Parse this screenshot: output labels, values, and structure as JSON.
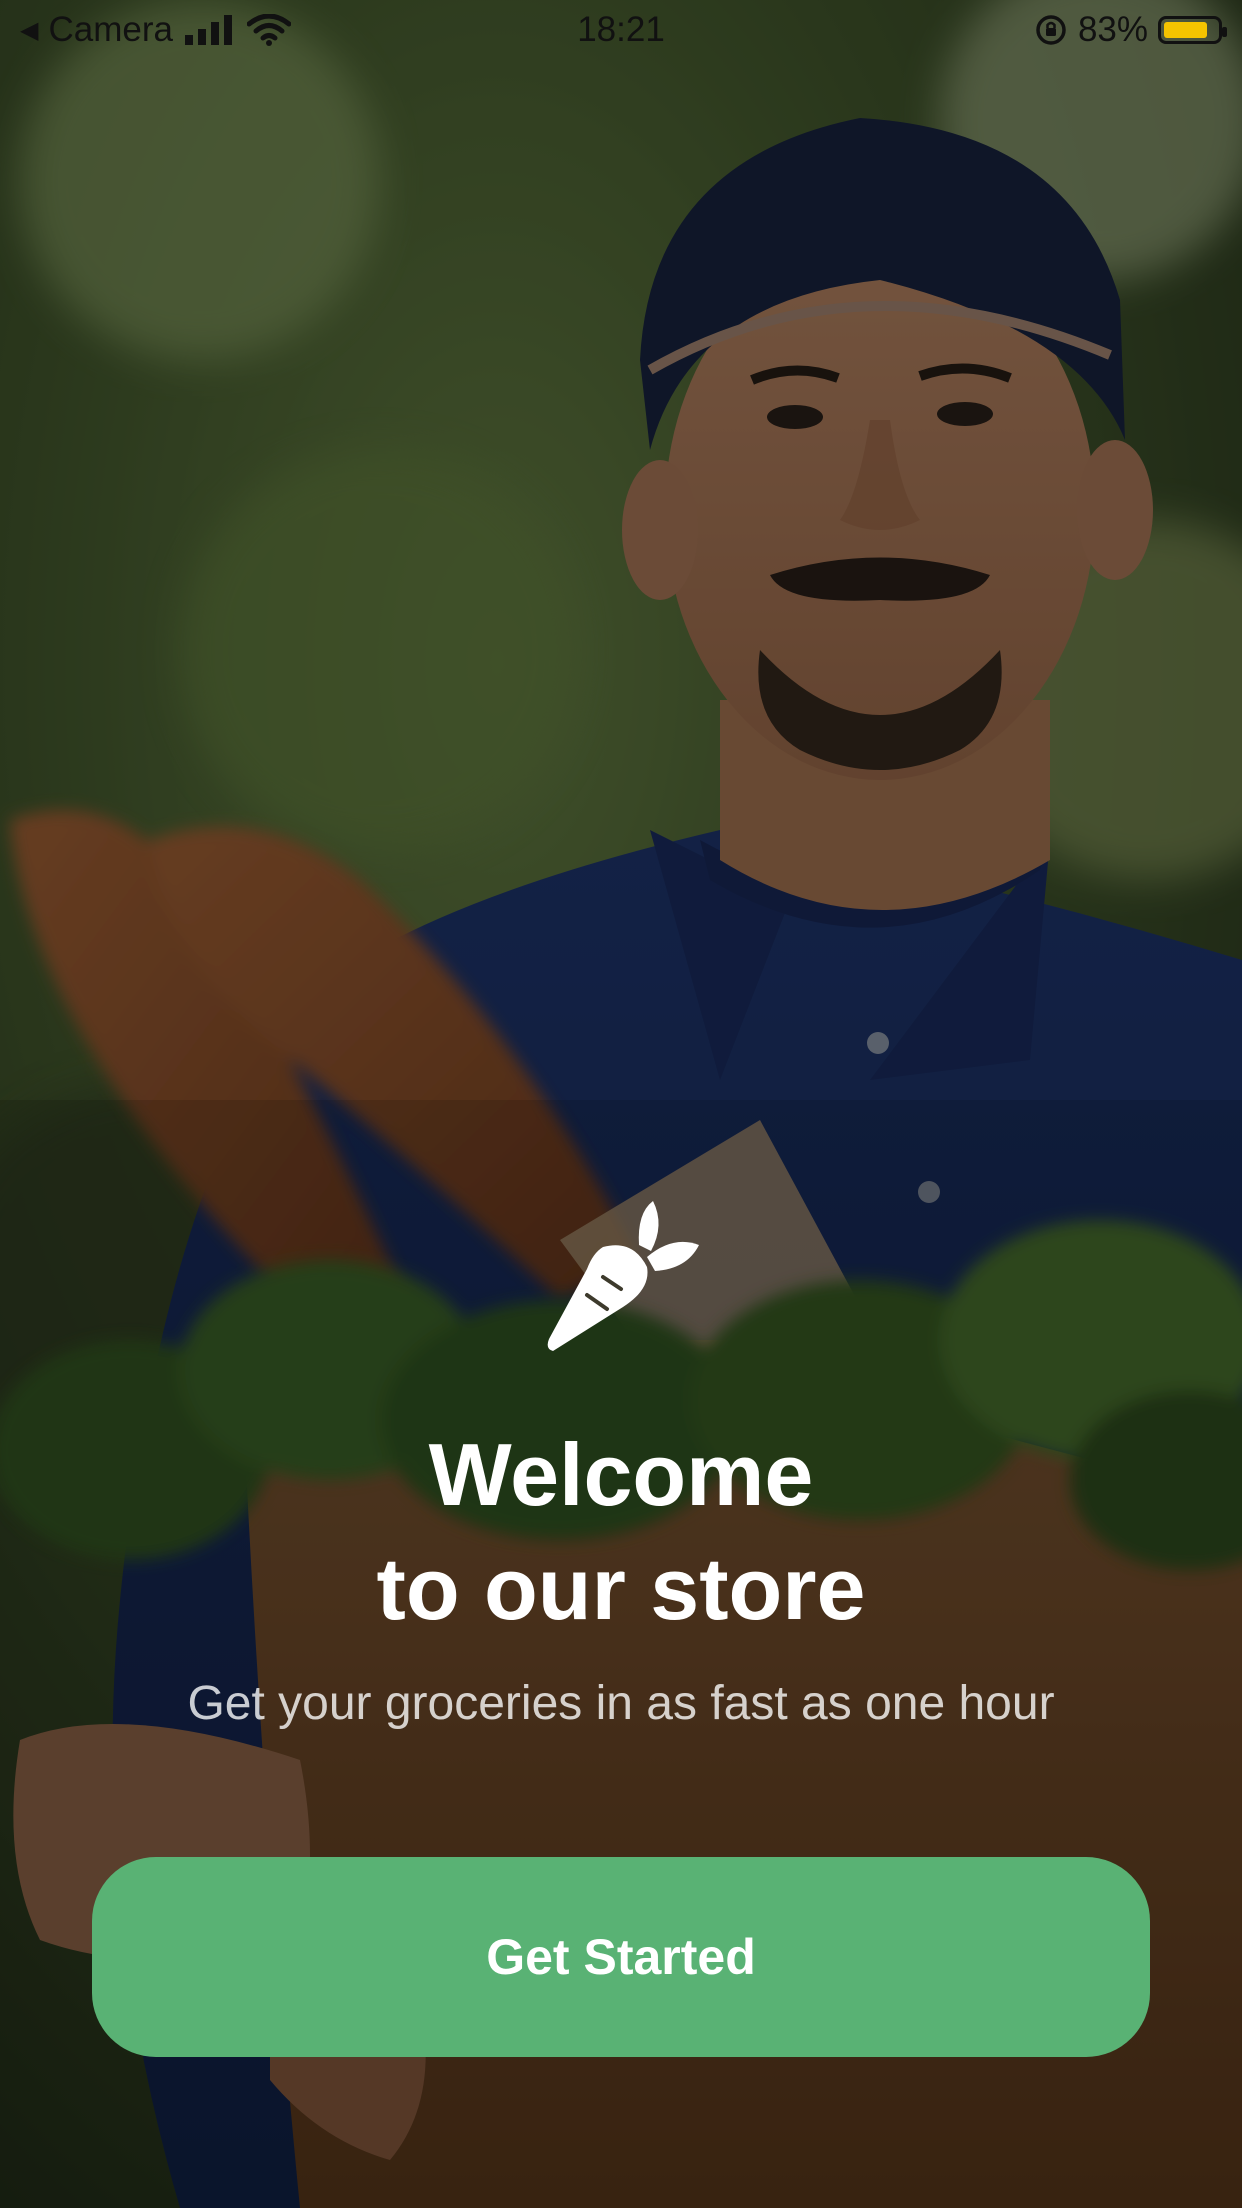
{
  "status_bar": {
    "back_app": "Camera",
    "time": "18:21",
    "battery_percent": "83%",
    "battery_level": 0.83,
    "battery_color": "#f5c400"
  },
  "hero": {
    "logo_icon": "carrot-icon",
    "title_line1": "Welcome",
    "title_line2": "to our store",
    "subtitle": "Get your groceries in as fast as one hour"
  },
  "actions": {
    "primary_label": "Get Started",
    "primary_color": "#59b274"
  }
}
